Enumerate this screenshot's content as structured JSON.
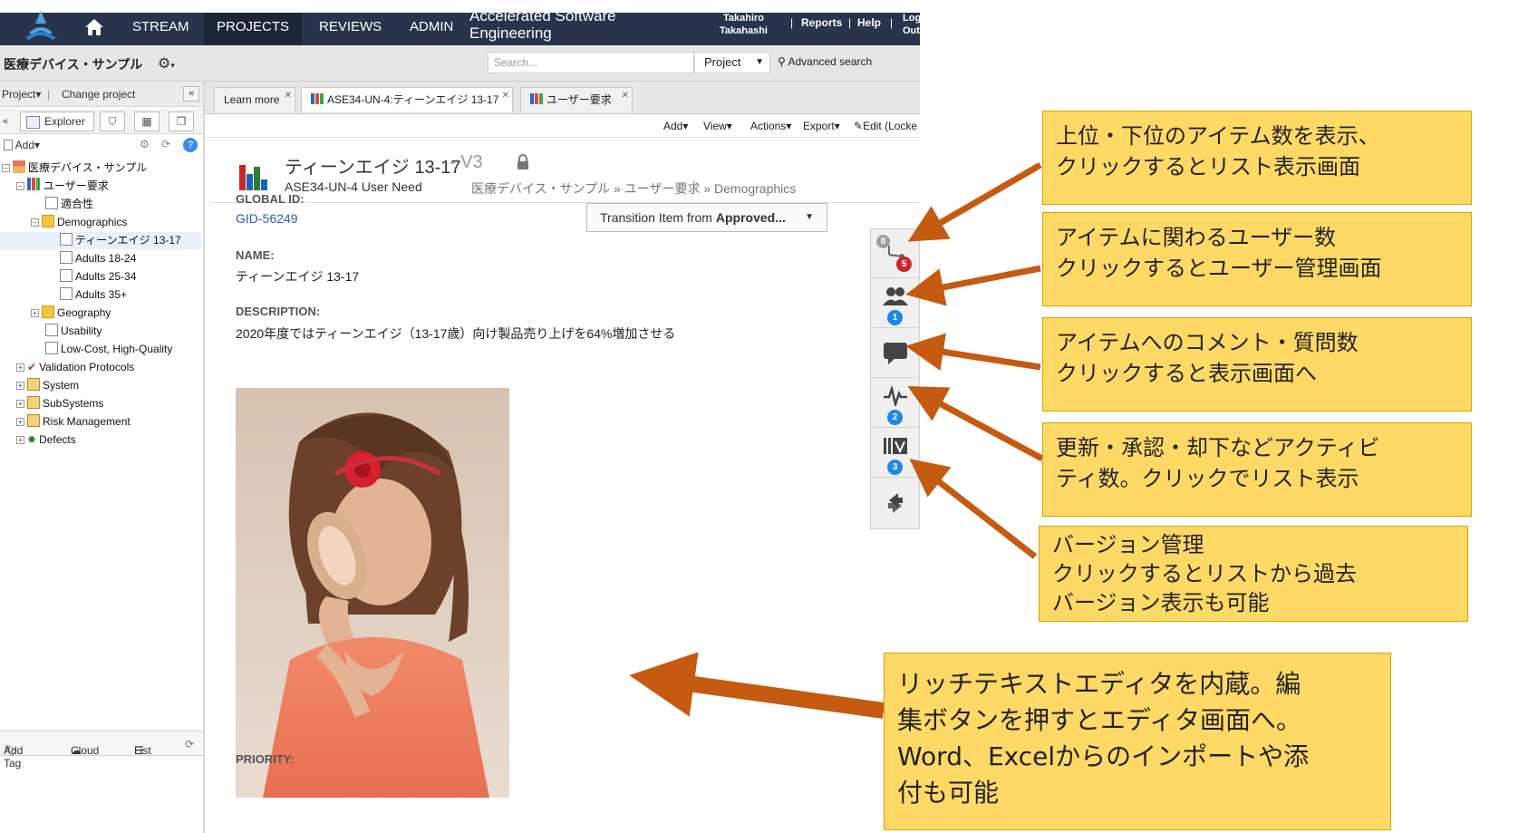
{
  "nav": {
    "stream": "STREAM",
    "projects": "PROJECTS",
    "reviews": "REVIEWS",
    "admin": "ADMIN",
    "title_line1": "Accelerated Software",
    "title_line2": "Engineering",
    "user_first": "Takahiro",
    "user_last": "Takahashi",
    "reports": "Reports",
    "help": "Help",
    "logout_line1": "Log",
    "logout_line2": "Out",
    "separator": "|"
  },
  "projectbar": {
    "project_name": "医療デバイス・サンプル",
    "search_placeholder": "Search...",
    "scope_value": "Project",
    "advanced_search": "Advanced search"
  },
  "leftpanel": {
    "project_menu": "Project",
    "change_project": "Change project",
    "explorer_tab": "Explorer",
    "add_button": "Add",
    "bottom_add_tag": "Add Tag",
    "bottom_cloud": "Cloud",
    "bottom_list": "List",
    "tree": [
      {
        "label": "医療デバイス・サンプル",
        "icon": "project-icon"
      },
      {
        "label": "ユーザー要求",
        "icon": "chart-icon"
      },
      {
        "label": "適合性",
        "icon": "document-icon"
      },
      {
        "label": "Demographics",
        "icon": "folder-icon"
      },
      {
        "label": "ティーンエイジ 13-17",
        "icon": "document-icon"
      },
      {
        "label": "Adults 18-24",
        "icon": "document-icon"
      },
      {
        "label": "Adults 25-34",
        "icon": "document-icon"
      },
      {
        "label": "Adults 35+",
        "icon": "document-icon"
      },
      {
        "label": "Geography",
        "icon": "folder-icon"
      },
      {
        "label": "Usability",
        "icon": "document-icon"
      },
      {
        "label": "Low-Cost, High-Quality",
        "icon": "document-icon"
      },
      {
        "label": "Validation Protocols",
        "icon": "checkmark-icon"
      },
      {
        "label": "System",
        "icon": "grid-icon"
      },
      {
        "label": "SubSystems",
        "icon": "grid-icon"
      },
      {
        "label": "Risk Management",
        "icon": "grid-icon"
      },
      {
        "label": "Defects",
        "icon": "bug-icon"
      }
    ]
  },
  "tabs": [
    {
      "label": "Learn more"
    },
    {
      "label": "ASE34-UN-4:ティーンエイジ 13-17"
    },
    {
      "label": "ユーザー要求"
    }
  ],
  "actions": {
    "add": "Add",
    "view": "View",
    "actions": "Actions",
    "export": "Export",
    "edit": "Edit (Locke"
  },
  "item": {
    "title": "ティーンエイジ 13-17",
    "version": "- V3",
    "key": "ASE34-UN-4",
    "type": "User Need",
    "breadcrumb": "医療デバイス・サンプル » ユーザー要求 » Demographics",
    "transition_prefix": "Transition Item from ",
    "transition_state": "Approved...",
    "global_id_label": "GLOBAL ID:",
    "global_id": "GID-56249",
    "name_label": "NAME:",
    "name": "ティーンエイジ 13-17",
    "description_label": "DESCRIPTION:",
    "description": "2020年度ではティーンエイジ（13-17歳）向け製品売り上げを64%増加させる",
    "priority_label": "PRIORITY:"
  },
  "iconstrip": {
    "relations_up": "0",
    "relations_down": "5",
    "users": "1",
    "activities": "2",
    "versions": "3"
  },
  "callouts": {
    "c1": "上位・下位のアイテム数を表示、\nクリックするとリスト表示画面",
    "c2": "アイテムに関わるユーザー数\nクリックするとユーザー管理画面",
    "c3": "アイテムへのコメント・質問数\nクリックすると表示画面へ",
    "c4": "更新・承認・却下などアクティビ\nティ数。クリックでリスト表示",
    "c5": "バージョン管理\nクリックするとリストから過去\nバージョン表示も可能",
    "c6": "リッチテキストエディタを内蔵。編\n集ボタンを押すとエディタ画面へ。\nWord、Excelからのインポートや添\n付も可能"
  },
  "colors": {
    "nav_bg": "#27344b",
    "callout_bg": "#ffd966",
    "arrow": "#c55a11",
    "badge_blue": "#1e88e5",
    "badge_red": "#c62828"
  }
}
